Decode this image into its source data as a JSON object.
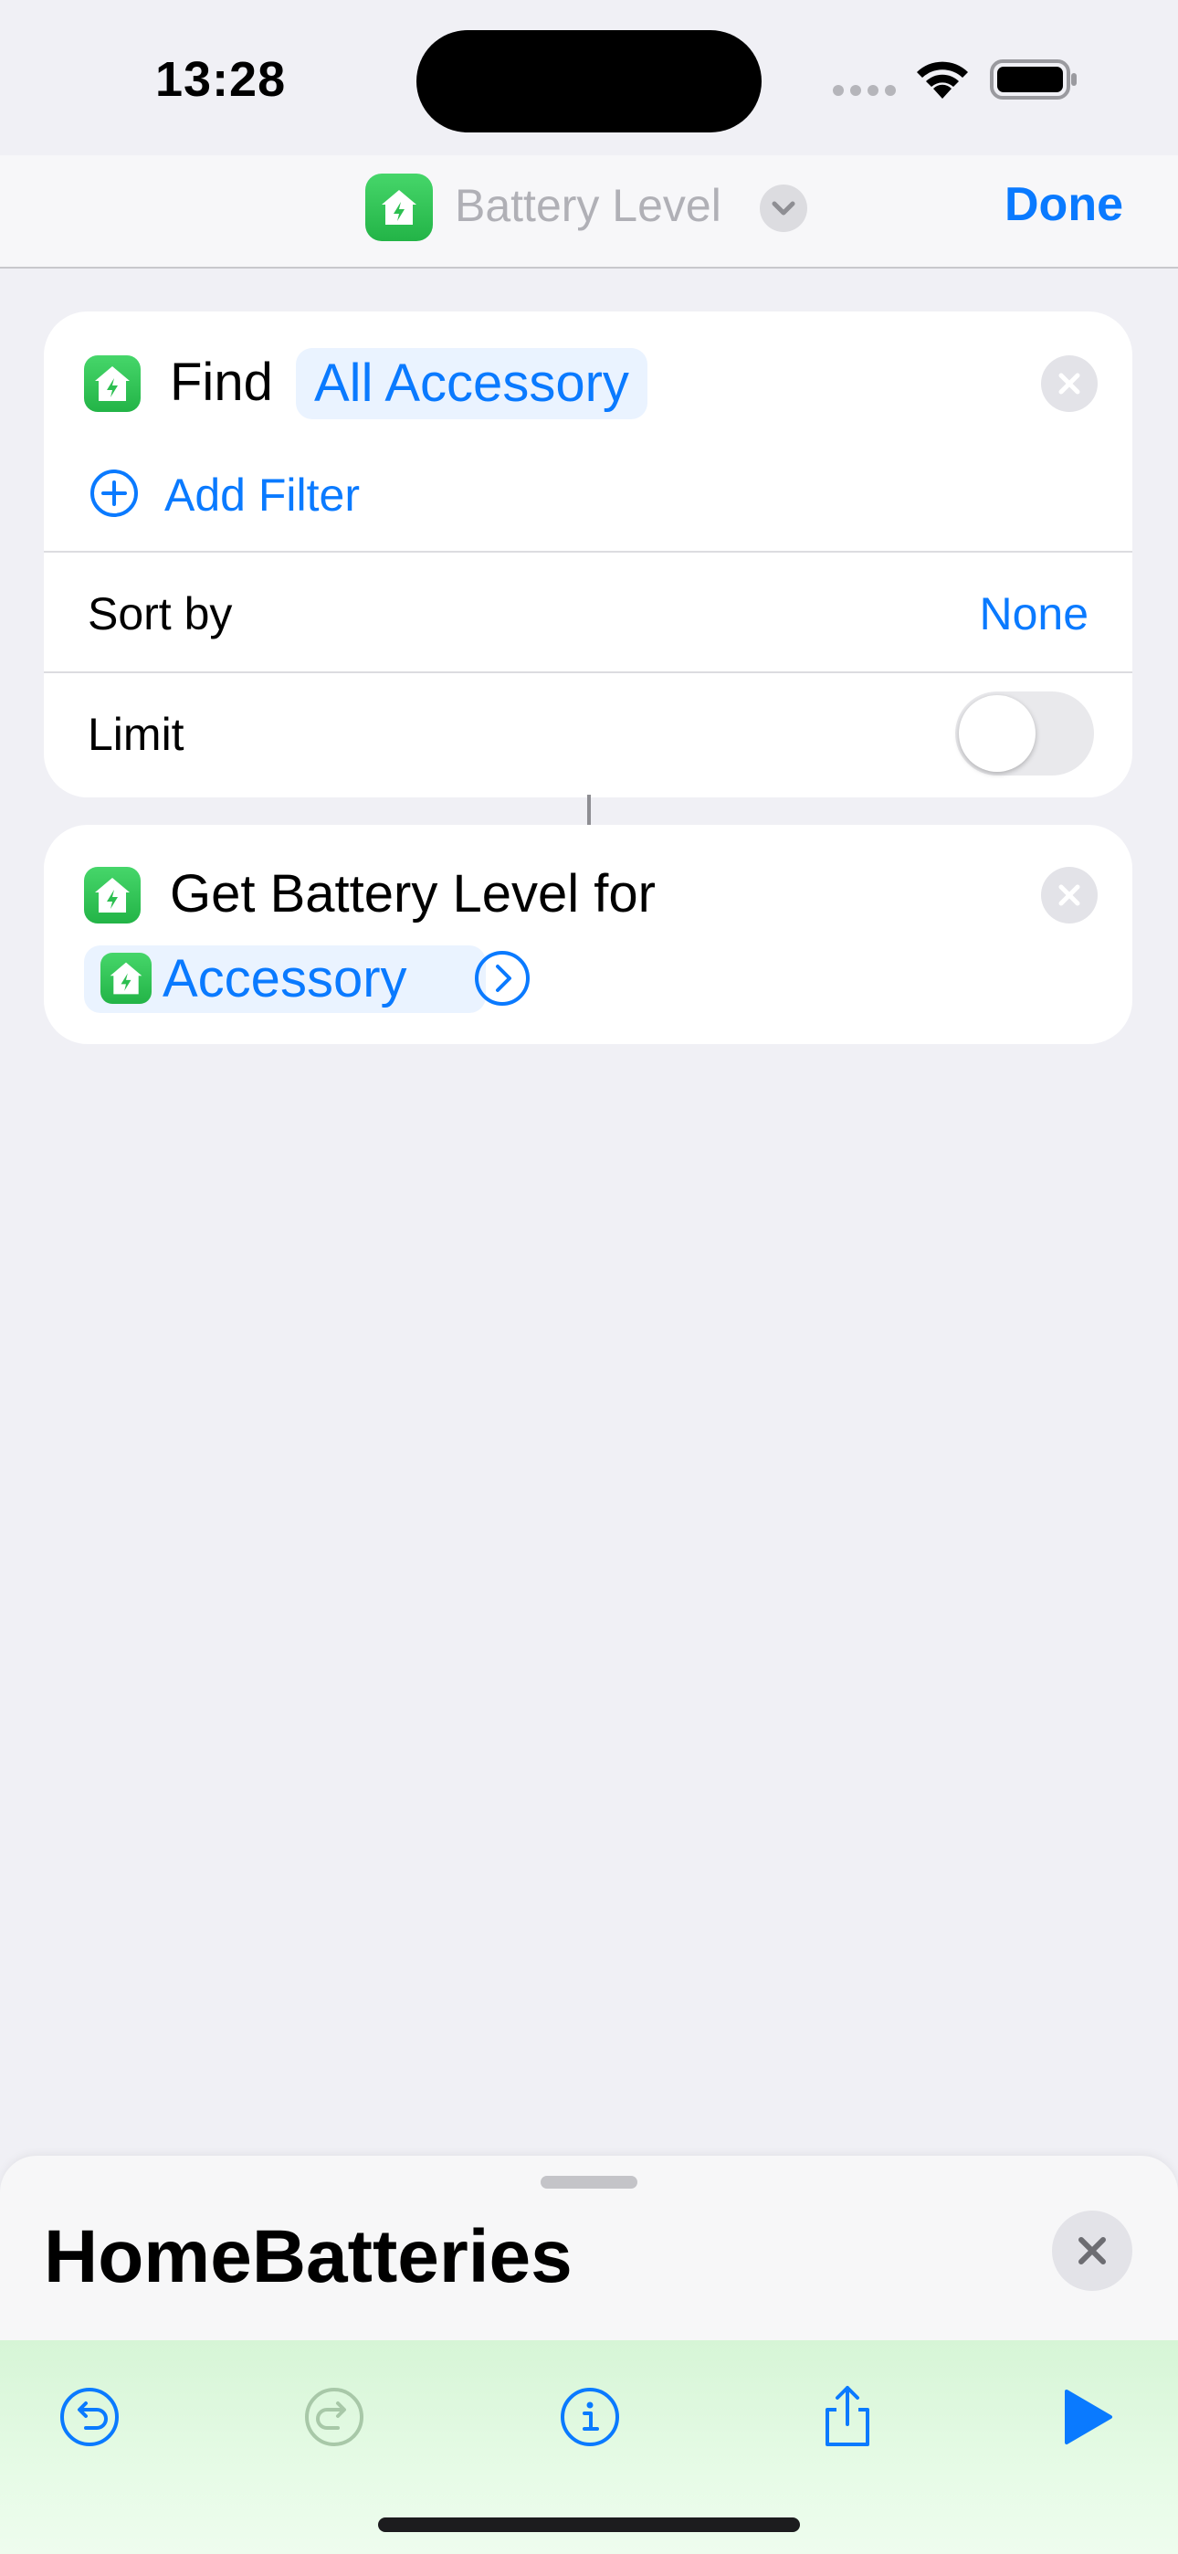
{
  "status_bar": {
    "time": "13:28"
  },
  "nav": {
    "title": "Battery Level",
    "done_label": "Done"
  },
  "find_action": {
    "verb": "Find",
    "target": "All Accessory",
    "add_filter": "Add Filter",
    "sort_by_label": "Sort by",
    "sort_by_value": "None",
    "limit_label": "Limit",
    "limit_enabled": false
  },
  "battery_action": {
    "label": "Get Battery Level for",
    "input": "Accessory"
  },
  "sheet": {
    "title": "HomeBatteries"
  },
  "toolbar": {
    "icons": [
      "undo-icon",
      "redo-icon",
      "info-icon",
      "share-icon",
      "play-icon"
    ]
  },
  "colors": {
    "accent": "#0A7AFF",
    "home_app": "#34C759"
  }
}
